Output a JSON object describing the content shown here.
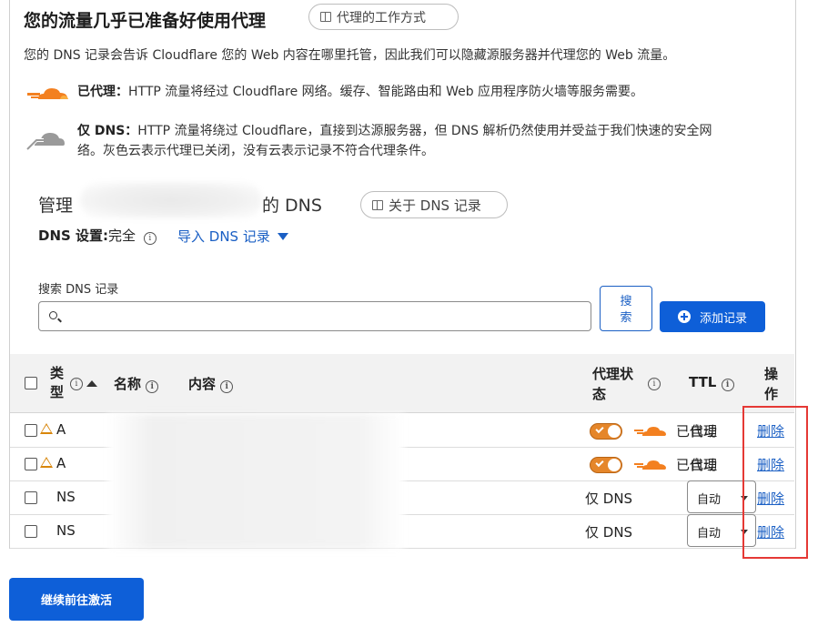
{
  "header": {
    "title": "您的流量几乎已准备好使用代理",
    "how_proxy_works_label": "代理的工作方式"
  },
  "intro": "您的 DNS 记录会告诉 Cloudflare 您的 Web 内容在哪里托管，因此我们可以隐藏源服务器并代理您的 Web 流量。",
  "proxied": {
    "label": "已代理：",
    "text": "HTTP 流量将经过 Cloudflare 网络。缓存、智能路由和 Web 应用程序防火墙等服务需要。"
  },
  "dns_only": {
    "label": "仅 DNS：",
    "text_line1": "HTTP 流量将绕过 Cloudflare，直接到达源服务器，但 DNS 解析仍然使用并受益于我们快速的安全网",
    "text_line2": "络。灰色云表示代理已关闭，没有云表示记录不符合代理条件。"
  },
  "manage": {
    "prefix": "管理",
    "suffix": "的 DNS",
    "about_dns_label": "关于 DNS 记录",
    "setting_label": "DNS 设置:",
    "setting_value": "完全",
    "import_label": "导入 DNS 记录"
  },
  "search": {
    "label": "搜索 DNS 记录",
    "placeholder": "",
    "button_line1": "搜",
    "button_line2": "索",
    "add_label": "添加记录"
  },
  "table": {
    "headers": {
      "type_line1": "类",
      "type_line2": "型",
      "name": "名称",
      "content": "内容",
      "proxy_line1": "代理状",
      "proxy_line2": "态",
      "ttl": "TTL",
      "actions_line1": "操",
      "actions_line2": "作"
    },
    "rows": [
      {
        "type": "A",
        "proxy_status": "已代理",
        "ttl": "自动",
        "action": "删除"
      },
      {
        "type": "A",
        "proxy_status": "已代理",
        "ttl": "自动",
        "action": "删除"
      },
      {
        "type": "NS",
        "proxy_status": "仅 DNS",
        "ttl": "自动",
        "action": "删除"
      },
      {
        "type": "NS",
        "proxy_status": "仅 DNS",
        "ttl": "自动",
        "action": "删除"
      }
    ]
  },
  "footer": {
    "continue_label": "继续前往激活"
  },
  "colors": {
    "accent": "#0e5fd8",
    "link": "#1a5fc4",
    "proxy_orange": "#f38020",
    "highlight_red": "#e53935"
  }
}
